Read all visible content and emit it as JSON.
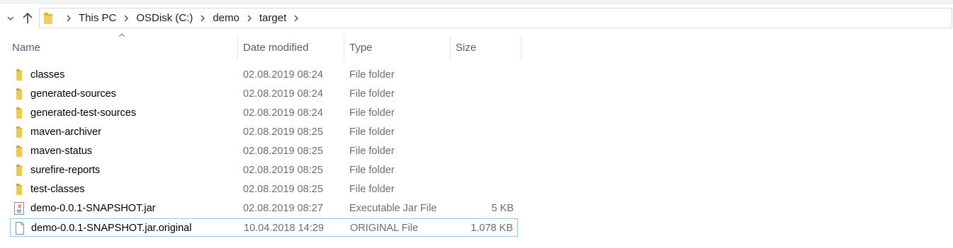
{
  "nav": {
    "back_icon": "chevron-down-icon",
    "up_icon": "up-arrow-icon"
  },
  "address": {
    "icon": "folder-icon",
    "crumbs": [
      "This PC",
      "OSDisk (C:)",
      "demo",
      "target"
    ]
  },
  "columns": {
    "name": "Name",
    "date": "Date modified",
    "type": "Type",
    "size": "Size"
  },
  "files": [
    {
      "name": "classes",
      "date": "02.08.2019 08:24",
      "type": "File folder",
      "size": "",
      "icon": "folder-icon"
    },
    {
      "name": "generated-sources",
      "date": "02.08.2019 08:24",
      "type": "File folder",
      "size": "",
      "icon": "folder-icon"
    },
    {
      "name": "generated-test-sources",
      "date": "02.08.2019 08:24",
      "type": "File folder",
      "size": "",
      "icon": "folder-icon"
    },
    {
      "name": "maven-archiver",
      "date": "02.08.2019 08:25",
      "type": "File folder",
      "size": "",
      "icon": "folder-icon"
    },
    {
      "name": "maven-status",
      "date": "02.08.2019 08:25",
      "type": "File folder",
      "size": "",
      "icon": "folder-icon"
    },
    {
      "name": "surefire-reports",
      "date": "02.08.2019 08:25",
      "type": "File folder",
      "size": "",
      "icon": "folder-icon"
    },
    {
      "name": "test-classes",
      "date": "02.08.2019 08:25",
      "type": "File folder",
      "size": "",
      "icon": "folder-icon"
    },
    {
      "name": "demo-0.0.1-SNAPSHOT.jar",
      "date": "02.08.2019 08:27",
      "type": "Executable Jar File",
      "size": "5 KB",
      "icon": "jar-file-icon"
    },
    {
      "name": "demo-0.0.1-SNAPSHOT.jar.original",
      "date": "10.04.2018 14:29",
      "type": "ORIGINAL File",
      "size": "1.078 KB",
      "icon": "document-icon",
      "focused": true
    }
  ],
  "colors": {
    "folder": "#e8b730",
    "header_text": "#4c607a",
    "focus_border": "#99c7df"
  }
}
